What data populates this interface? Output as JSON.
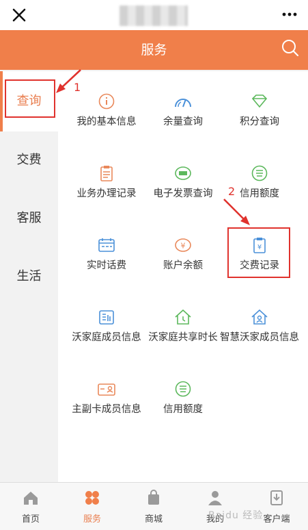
{
  "header": {
    "title": "服务"
  },
  "sidebar": {
    "items": [
      {
        "label": "查询"
      },
      {
        "label": "交费"
      },
      {
        "label": "客服"
      },
      {
        "label": "生活"
      }
    ]
  },
  "grid": {
    "items": [
      {
        "label": "我的基本信息",
        "icon": "info-icon"
      },
      {
        "label": "余量查询",
        "icon": "gauge-icon"
      },
      {
        "label": "积分查询",
        "icon": "diamond-icon"
      },
      {
        "label": "业务办理记录",
        "icon": "clipboard-icon"
      },
      {
        "label": "电子发票查询",
        "icon": "invoice-icon"
      },
      {
        "label": "信用额度",
        "icon": "credit-icon"
      },
      {
        "label": "实时话费",
        "icon": "calendar-icon"
      },
      {
        "label": "账户余额",
        "icon": "yen-icon"
      },
      {
        "label": "交费记录",
        "icon": "payment-record-icon"
      },
      {
        "label": "沃家庭成员信息",
        "icon": "family-list-icon"
      },
      {
        "label": "沃家庭共享时长",
        "icon": "home-clock-icon"
      },
      {
        "label": "智慧沃家成员信息",
        "icon": "smart-home-icon"
      },
      {
        "label": "主副卡成员信息",
        "icon": "card-icon"
      },
      {
        "label": "信用额度",
        "icon": "credit-icon"
      }
    ]
  },
  "annotations": {
    "first": "1",
    "second": "2"
  },
  "tabs": [
    {
      "label": "首页"
    },
    {
      "label": "服务"
    },
    {
      "label": "商城"
    },
    {
      "label": "我的"
    },
    {
      "label": "客户端"
    }
  ],
  "watermark": {
    "text": "Baidu 经验"
  },
  "colors": {
    "accent": "#f07f4a",
    "orange_icon": "#e9885a",
    "blue_icon": "#4a90d9",
    "green_icon": "#5cb85c",
    "annotation": "#e0322d"
  }
}
